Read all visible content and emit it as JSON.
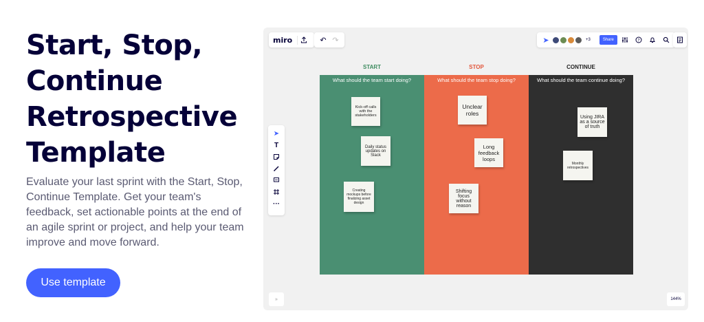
{
  "hero": {
    "title": "Start, Stop, Continue Retrospective Template",
    "description": "Evaluate your last sprint with the Start, Stop, Continue Template. Get your team's feedback, set actionable points at the end of an agile sprint or project, and help your team improve and move forward.",
    "cta_label": "Use template"
  },
  "board": {
    "logo": "miro",
    "share_label": "Share",
    "collaborator_count": "+3",
    "zoom": "144%",
    "expand_label": "»",
    "columns": [
      {
        "header": "START",
        "question": "What should the team start doing?",
        "color": "#4a8f72",
        "header_color": "#3d8b5f",
        "notes": [
          {
            "text": "Kick-off calls with the stakeholders"
          },
          {
            "text": "Daily status updates on Slack"
          },
          {
            "text": "Creating mockups before finalizing asset design"
          }
        ]
      },
      {
        "header": "STOP",
        "question": "What should the team stop doing?",
        "color": "#ec6b4a",
        "header_color": "#e2553a",
        "notes": [
          {
            "text": "Unclear roles"
          },
          {
            "text": "Long feedback loops"
          },
          {
            "text": "Shifting focus without reason"
          }
        ]
      },
      {
        "header": "CONTINUE",
        "question": "What should the team continue doing?",
        "color": "#2f2f2f",
        "header_color": "#222222",
        "notes": [
          {
            "text": "Using JIRA as a source of truth"
          },
          {
            "text": "Monthly retrospectives"
          }
        ]
      }
    ]
  },
  "colors": {
    "accent": "#4262ff",
    "title_text": "#050038",
    "body_text": "#5a5a72",
    "board_background": "#f1f1f1"
  }
}
